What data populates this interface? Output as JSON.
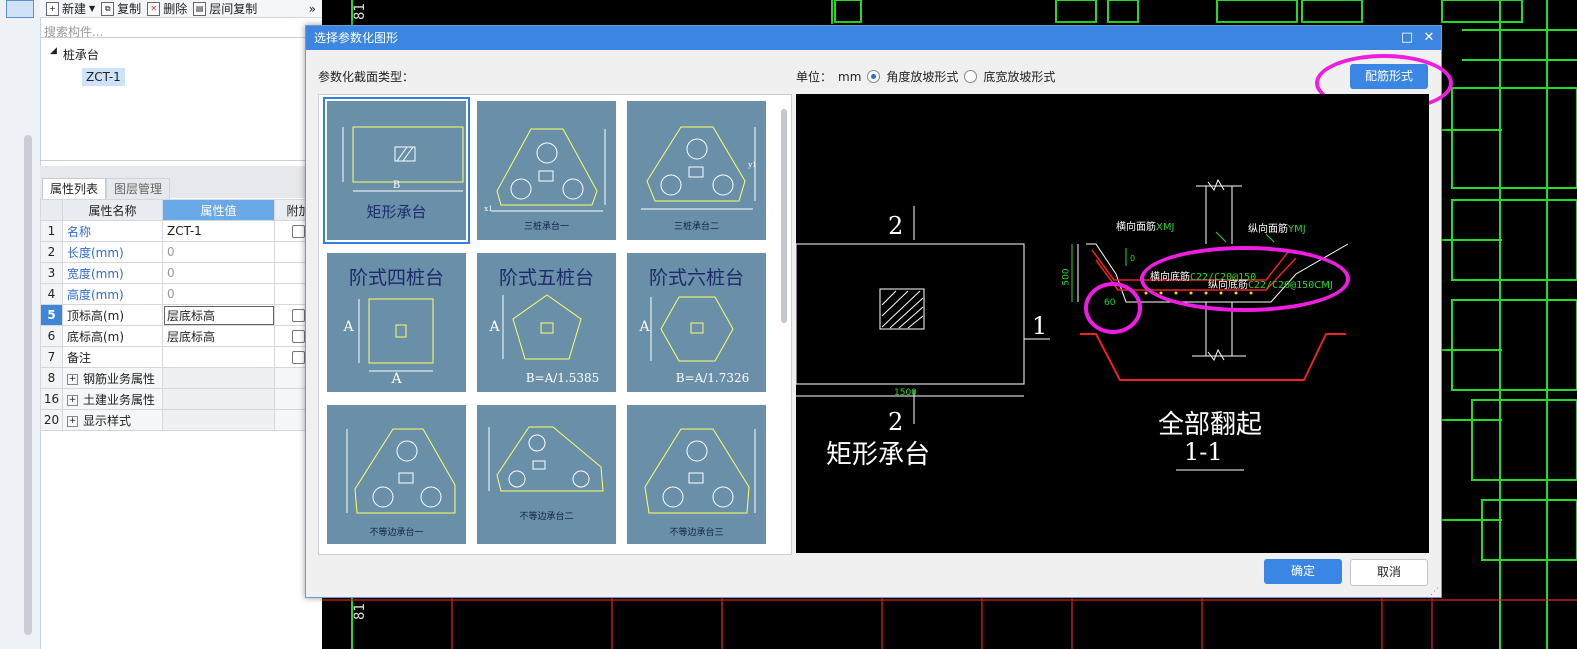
{
  "toolbar": {
    "new": "新建",
    "copy": "复制",
    "delete": "删除",
    "layer_copy": "层间复制",
    "more": "»"
  },
  "search": {
    "placeholder": "搜索构件..."
  },
  "tree": {
    "root": "桩承台",
    "child": "ZCT-1"
  },
  "prop_tabs": {
    "props": "属性列表",
    "layers": "图层管理"
  },
  "prop_table": {
    "headers": [
      "属性名称",
      "属性值",
      "附加"
    ],
    "rows": [
      {
        "idx": "1",
        "name": "名称",
        "value": "ZCT-1"
      },
      {
        "idx": "2",
        "name": "长度(mm)",
        "value": "0"
      },
      {
        "idx": "3",
        "name": "宽度(mm)",
        "value": "0"
      },
      {
        "idx": "4",
        "name": "高度(mm)",
        "value": "0"
      },
      {
        "idx": "5",
        "name": "顶标高(m)",
        "value": "层底标高"
      },
      {
        "idx": "6",
        "name": "底标高(m)",
        "value": "层底标高"
      },
      {
        "idx": "7",
        "name": "备注",
        "value": ""
      },
      {
        "idx": "8",
        "name": "钢筋业务属性",
        "value": ""
      },
      {
        "idx": "16",
        "name": "土建业务属性",
        "value": ""
      },
      {
        "idx": "20",
        "name": "显示样式",
        "value": ""
      }
    ]
  },
  "dialog": {
    "title": "选择参数化图形",
    "restore": "□",
    "close": "✕",
    "section_label": "参数化截面类型：",
    "unit_label": "单位：",
    "unit_value": "mm",
    "radio_angle": "角度放坡形式",
    "radio_width": "底宽放坡形式",
    "rebar_button": "配筋形式",
    "ok": "确定",
    "cancel": "取消"
  },
  "thumbnails": {
    "t1": {
      "caption": "矩形承台",
      "dim_a": "A",
      "dim_b": "B"
    },
    "t2": {
      "caption": "三桩承台一"
    },
    "t3": {
      "caption": "三桩承台二"
    },
    "t4": {
      "caption": "阶式四桩台",
      "dim_a": "A",
      "dim_b": "A"
    },
    "t5": {
      "caption": "阶式五桩台",
      "dim_a": "A",
      "dim_b": "B=A/1.5385"
    },
    "t6": {
      "caption": "阶式六桩台",
      "dim_a": "A",
      "dim_b": "B=A/1.7326"
    },
    "t7": {
      "caption": "不等边承台一"
    },
    "t8": {
      "caption": "不等边承台二"
    },
    "t9": {
      "caption": "不等边承台三"
    },
    "dim_x": "x1",
    "dim_y": "y1"
  },
  "preview": {
    "plan_title": "矩形承台",
    "section_mark": "2",
    "section_mark_1": "1",
    "width_dim": "1500",
    "height_dim": "500",
    "section_title": "全部翻起",
    "section_id": "1-1",
    "labels": {
      "top_transverse": "横向面筋",
      "top_transverse_code": "XMJ",
      "top_longitudinal": "纵向面筋",
      "top_longitudinal_code": "YMJ",
      "bottom_transverse": "横向底筋",
      "bottom_transverse_spec": "C22/C20@150",
      "bottom_longitudinal": "纵向底筋",
      "bottom_longitudinal_spec": "C22/C20@150",
      "bottom_longitudinal_code": "CMJ",
      "angle": "60",
      "zero": "0"
    }
  }
}
